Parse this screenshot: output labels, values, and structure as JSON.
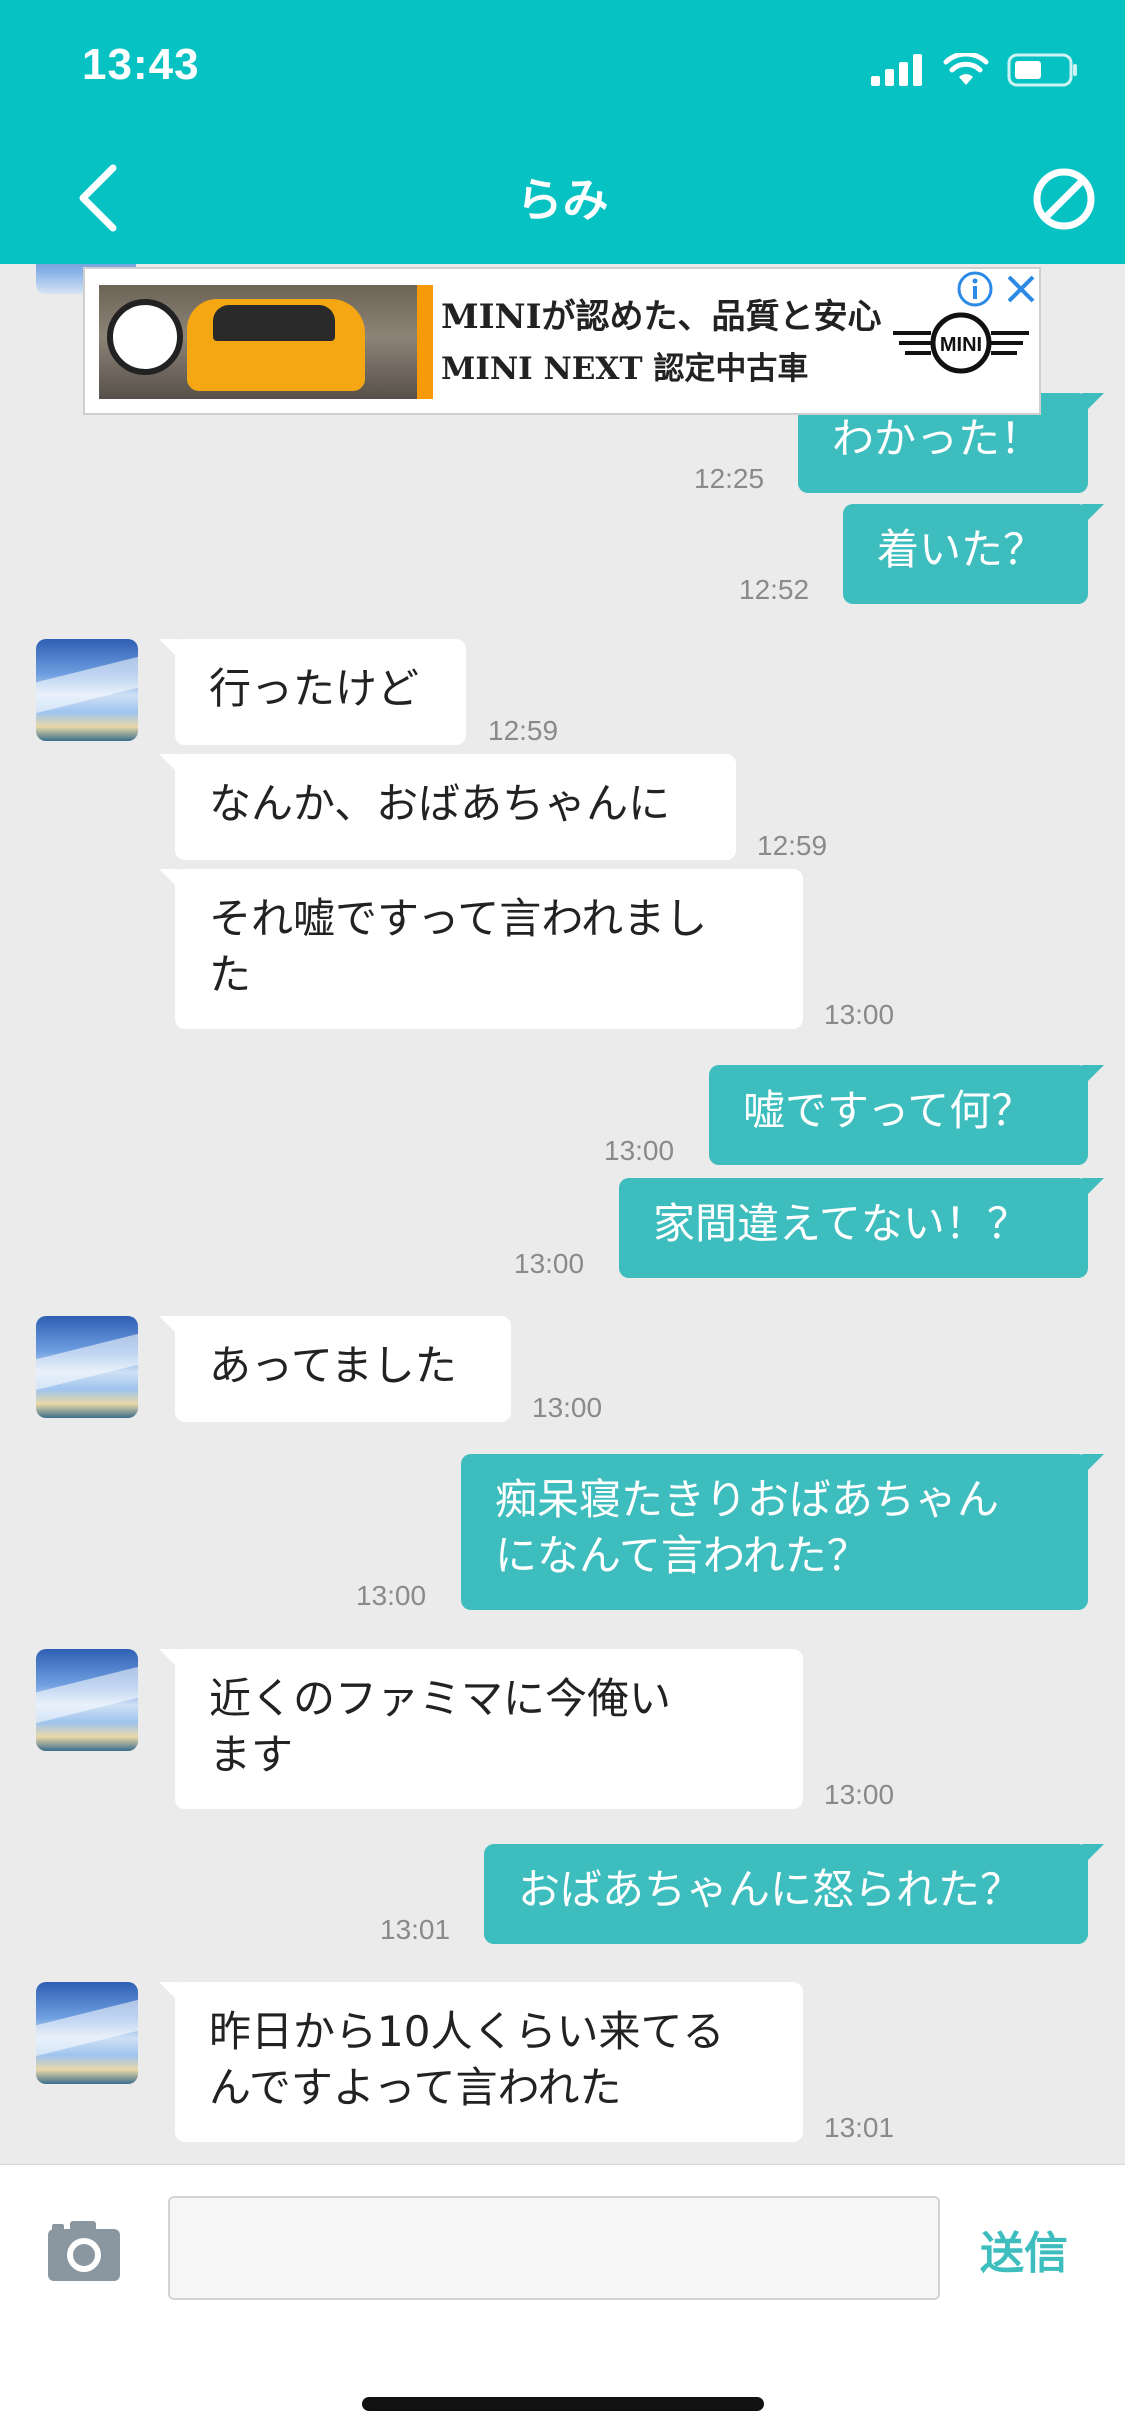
{
  "status_bar": {
    "time": "13:43"
  },
  "header": {
    "title": "らみ"
  },
  "ad": {
    "headline": "MINIが認めた、品質と安心",
    "subline": "MINI NEXT 認定中古車",
    "logo_text": "MINI"
  },
  "messages": [
    {
      "dir": "out",
      "text": "わかった！",
      "time": "12:25"
    },
    {
      "dir": "out",
      "text": "着いた？",
      "time": "12:52"
    },
    {
      "dir": "in",
      "text": "行ったけど",
      "time": "12:59"
    },
    {
      "dir": "in",
      "text": "なんか、おばあちゃんに",
      "time": "12:59"
    },
    {
      "dir": "in",
      "text": "それ嘘ですって言われまし\nた",
      "time": "13:00"
    },
    {
      "dir": "out",
      "text": "嘘ですって何？",
      "time": "13:00"
    },
    {
      "dir": "out",
      "text": "家間違えてない！？",
      "time": "13:00"
    },
    {
      "dir": "in",
      "text": "あってました",
      "time": "13:00"
    },
    {
      "dir": "out",
      "text": "痴呆寝たきりおばあちゃん\nになんて言われた？",
      "time": "13:00"
    },
    {
      "dir": "in",
      "text": "近くのファミマに今俺い\nます",
      "time": "13:00"
    },
    {
      "dir": "out",
      "text": "おばあちゃんに怒られた？",
      "time": "13:01"
    },
    {
      "dir": "in",
      "text": "昨日から10人くらい来てる\nんですよって言われた",
      "time": "13:01"
    }
  ],
  "input": {
    "placeholder": "",
    "value": ""
  },
  "send_label": "送信",
  "icons": {
    "back": "back-chevron-icon",
    "block": "block-icon",
    "camera": "camera-icon",
    "ad_info": "info-icon",
    "ad_close": "close-icon"
  },
  "colors": {
    "header": "#07c2c2",
    "outgoing_bubble": "#3dbdbd",
    "incoming_bubble": "#ffffff",
    "background": "#ebebeb"
  }
}
